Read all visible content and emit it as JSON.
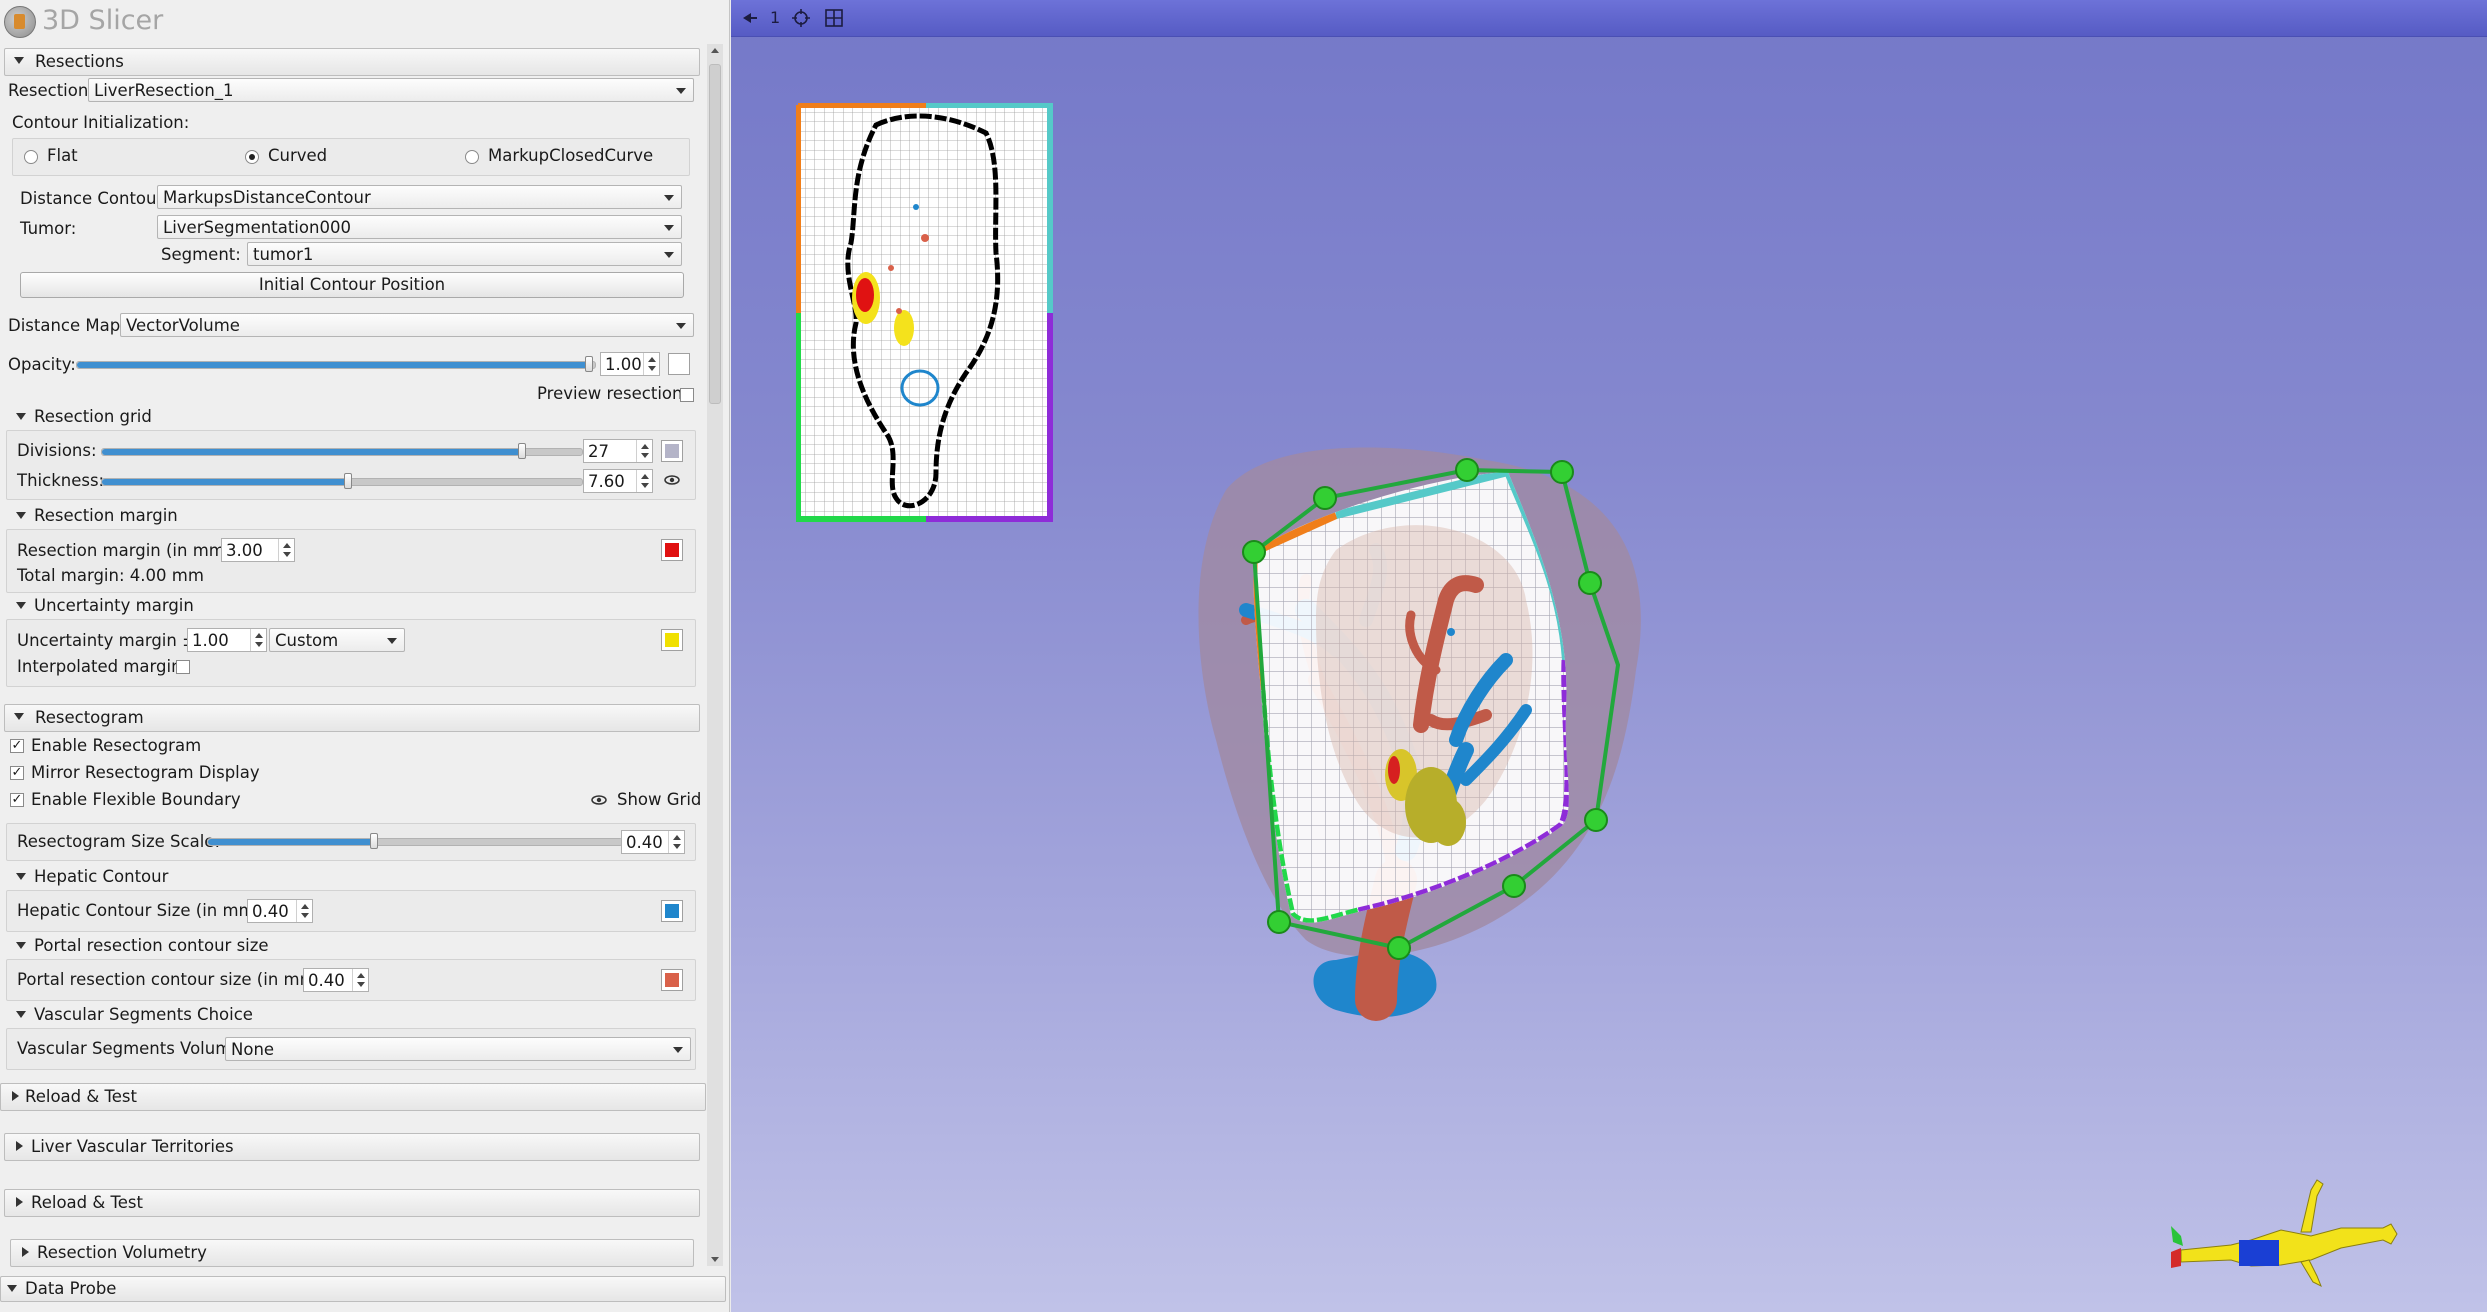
{
  "app": {
    "title": "3D Slicer"
  },
  "resections": {
    "header": "Resections",
    "resection_label": "Resection:",
    "resection_value": "LiverResection_1",
    "contour_init_label": "Contour Initialization:",
    "radio_flat": "Flat",
    "radio_curved": "Curved",
    "radio_markup": "MarkupClosedCurve",
    "distance_contour_label": "Distance Contour:",
    "distance_contour_value": "MarkupsDistanceContour",
    "tumor_label": "Tumor:",
    "tumor_value": "LiverSegmentation000",
    "segment_label": "Segment:",
    "segment_value": "tumor1",
    "initial_contour_button": "Initial Contour Position",
    "distance_map_label": "Distance Map:",
    "distance_map_value": "VectorVolume",
    "opacity_label": "Opacity:",
    "opacity_value": "1.00",
    "opacity_level": 1.0,
    "preview_label": "Preview resection:"
  },
  "grid": {
    "header": "Resection grid",
    "divisions_label": "Divisions:",
    "divisions_value": "27",
    "thickness_label": "Thickness:",
    "thickness_value": "7.60",
    "grid_color": "#b4b4c8"
  },
  "margin": {
    "header": "Resection margin",
    "margin_label": "Resection margin (in mm):",
    "margin_value": "3.00",
    "total_label": "Total margin: 4.00 mm",
    "color": "#e01010"
  },
  "uncertainty": {
    "header": "Uncertainty margin",
    "label": "Uncertainty margin ±:",
    "value": "1.00",
    "mode": "Custom",
    "interpolated_label": "Interpolated margin:",
    "color": "#f0e000"
  },
  "resectogram": {
    "header": "Resectogram",
    "enable": "Enable Resectogram",
    "mirror": "Mirror Resectogram Display",
    "flexible": "Enable Flexible Boundary",
    "show_grid": "Show Grid",
    "size_label": "Resectogram Size Scale:",
    "size_value": "0.40"
  },
  "hepatic": {
    "header": "Hepatic Contour",
    "label": "Hepatic Contour Size (in mm):",
    "value": "0.40",
    "color": "#1f86cc"
  },
  "portal": {
    "header": "Portal resection contour size",
    "label": "Portal resection contour size (in mm):",
    "value": "0.40",
    "color": "#d9614a"
  },
  "vascular": {
    "header": "Vascular Segments Choice",
    "label": "Vascular Segments Volume",
    "value": "None"
  },
  "sections": {
    "reload1": "Reload & Test",
    "territories": "Liver Vascular Territories",
    "reload2": "Reload & Test",
    "volumetry": "Resection Volumetry",
    "probe": "Data Probe"
  },
  "viewer": {
    "pin_icon": "pin-icon",
    "view_number": "1",
    "center_icon": "crosshair-icon",
    "layout_icon": "layout-grid-icon"
  }
}
